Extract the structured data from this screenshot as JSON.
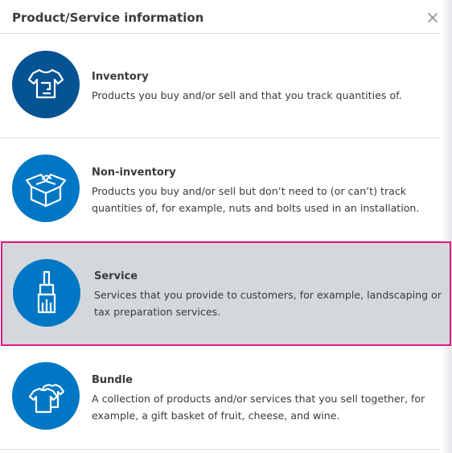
{
  "dialog": {
    "title": "Product/Service information",
    "close_icon": "close-icon"
  },
  "options": [
    {
      "title": "Inventory",
      "description": "Products you buy and/or sell and that you track quantities of.",
      "icon": "tshirt-tag-icon",
      "selected": false
    },
    {
      "title": "Non-inventory",
      "description": "Products you buy and/or sell but don’t need to (or can’t) track quantities of, for example, nuts and bolts used in an installation.",
      "icon": "open-box-icon",
      "selected": false
    },
    {
      "title": "Service",
      "description": "Services that you provide to customers, for example, landscaping or tax preparation services.",
      "icon": "paintbrush-icon",
      "selected": true
    },
    {
      "title": "Bundle",
      "description": "A collection of products and/or services that you sell together, for example, a gift basket of fruit, cheese, and wine.",
      "icon": "bundle-shirts-icon",
      "selected": false
    }
  ],
  "colors": {
    "icon_bg": "#0077c5",
    "icon_bg_dark": "#055393",
    "selected_bg": "#d4d7dc",
    "selected_border": "#e0197d",
    "text": "#393a3d"
  }
}
